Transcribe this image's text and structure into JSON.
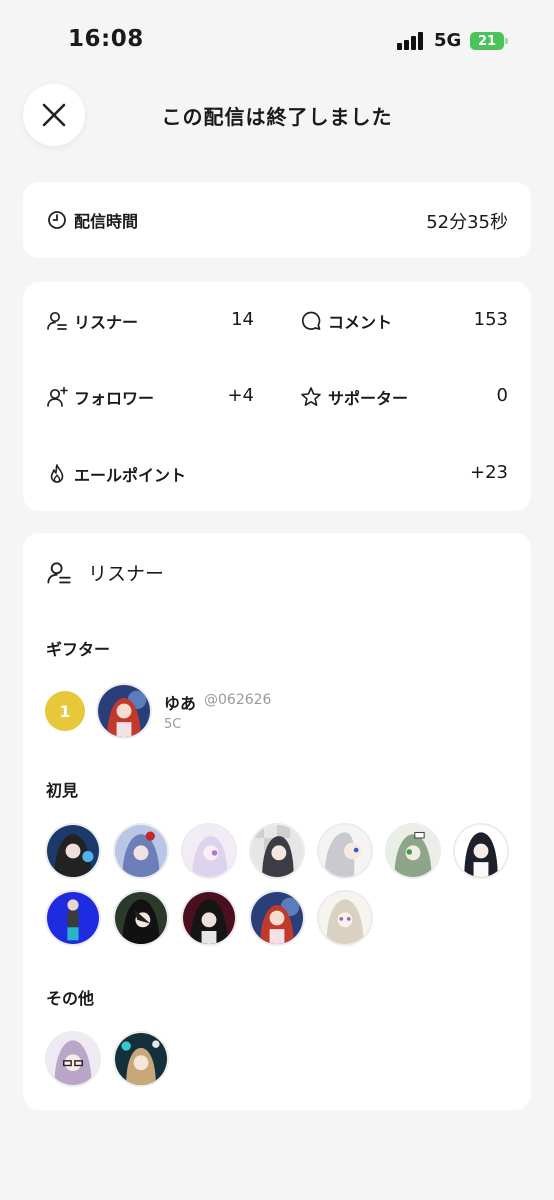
{
  "status_bar": {
    "time": "16:08",
    "network": "5G",
    "battery": "21"
  },
  "header": {
    "title": "この配信は終了しました"
  },
  "duration": {
    "label": "配信時間",
    "value": "52分35秒"
  },
  "stats": {
    "listeners": {
      "label": "リスナー",
      "value": "14"
    },
    "comments": {
      "label": "コメント",
      "value": "153"
    },
    "followers": {
      "label": "フォロワー",
      "value": "+4"
    },
    "supporters": {
      "label": "サポーター",
      "value": "0"
    },
    "yell_points": {
      "label": "エールポイント",
      "value": "+23"
    }
  },
  "listener_section": {
    "title": "リスナー",
    "gifters_title": "ギフター",
    "gifter": {
      "rank": "1",
      "name": "ゆあ",
      "handle": "@062626",
      "sub": "5C"
    },
    "first_time_title": "初見",
    "others_title": "その他"
  },
  "colors": {
    "background": "#f5f5f5",
    "card": "#ffffff",
    "rank_badge": "#e6c83a",
    "battery": "#4cc35a"
  },
  "icons": [
    "close-icon",
    "clock-icon",
    "listener-icon",
    "comment-icon",
    "follow-add-icon",
    "star-icon",
    "flame-icon"
  ]
}
